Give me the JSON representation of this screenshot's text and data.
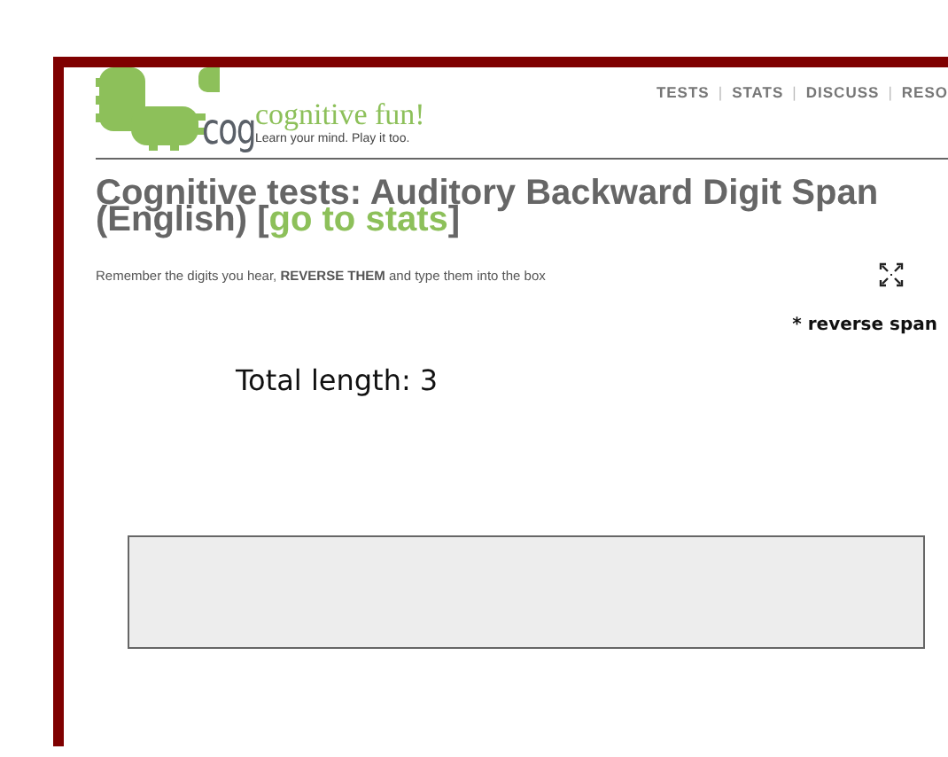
{
  "logo": {
    "mark": "cog",
    "name": "cognitive fun!",
    "tagline": "Learn your mind. Play it too."
  },
  "nav": {
    "separator": "|",
    "items": [
      {
        "label": "TESTS"
      },
      {
        "label": "STATS"
      },
      {
        "label": "DISCUSS"
      },
      {
        "label": "RESO"
      }
    ]
  },
  "title": {
    "before": "Cognitive tests: Auditory Backward Digit Span (English) [",
    "link": "go to stats",
    "after": "]"
  },
  "instructions": "Remember the digits you hear, **REVERSE THEM** and type them into the box",
  "mode_note": "* reverse span",
  "total_length": "Total length:  3"
}
